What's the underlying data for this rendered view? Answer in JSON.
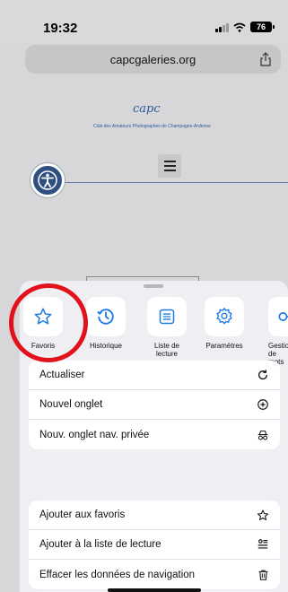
{
  "status": {
    "time": "19:32",
    "battery": "76"
  },
  "address": {
    "url": "capcgaleries.org"
  },
  "webpage": {
    "logo_text": "capc",
    "club_name": "Club des Amateurs Photographes de Champagne-Ardenne"
  },
  "quick_actions": [
    {
      "label": "Favoris",
      "icon": "star-icon"
    },
    {
      "label": "Historique",
      "icon": "clock-icon"
    },
    {
      "label": "Liste de lecture",
      "icon": "list-icon"
    },
    {
      "label": "Paramètres",
      "icon": "gear-icon"
    },
    {
      "label": "Gestion de mots",
      "icon": "key-icon"
    }
  ],
  "group1": [
    {
      "label": "Actualiser",
      "icon": "reload-icon"
    },
    {
      "label": "Nouvel onglet",
      "icon": "plus-circle-icon"
    },
    {
      "label": "Nouv. onglet nav. privée",
      "icon": "incognito-icon"
    }
  ],
  "group2": [
    {
      "label": "Ajouter aux favoris",
      "icon": "star-icon"
    },
    {
      "label": "Ajouter à la liste de lecture",
      "icon": "reading-list-icon"
    },
    {
      "label": "Effacer les données de navigation",
      "icon": "trash-icon"
    }
  ],
  "colors": {
    "accent": "#1b7ae4",
    "highlight": "#e1121b"
  }
}
